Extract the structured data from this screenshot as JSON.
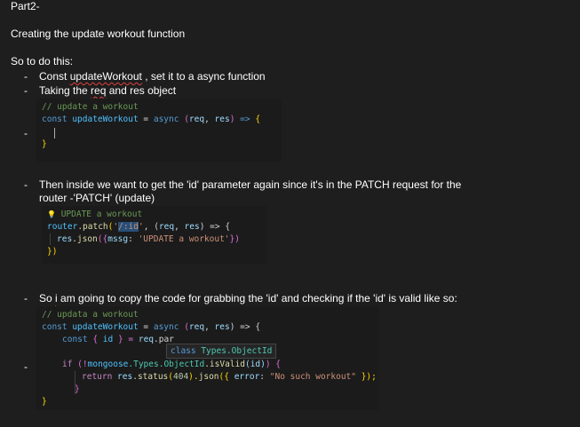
{
  "doc": {
    "part_title": "Part2-",
    "heading": "Creating the update workout function",
    "intro": "So to do this:",
    "bullets": {
      "b1_pre": "Const ",
      "b1_under": "updateWorkout",
      "b1_post": " , set it to a async function",
      "b2_pre": "Taking the ",
      "b2_under": "req",
      "b2_post": " and res object",
      "b4_line1": "Then inside we want to get the 'id' parameter again since it's in the PATCH request for the",
      "b4_line2": "router  -'PATCH' (update)",
      "b6_pre": "So ",
      "b6_under": "i",
      "b6_post": " am going to copy the code for grabbing the 'id' and checking if the 'id' is valid like so:"
    },
    "dash": "-"
  },
  "code1": {
    "comment": "// update a workout",
    "const": "const",
    "name": " updateWorkout",
    "eq": " = ",
    "async": "async",
    "params_open": " (",
    "req": "req",
    "comma": ", ",
    "res": "res",
    "params_close": ") ",
    "arrow": "=>",
    "brace_open": " {",
    "brace_close": "}"
  },
  "code2": {
    "bulb": "💡",
    "comment": " UPDATE a workout",
    "router": "router",
    "dot_patch": ".patch",
    "paren_open": "(",
    "str_q1": "'",
    "str_path": "/:id",
    "str_q2": "'",
    "comma": ", (",
    "req": "req",
    "comma2": ", ",
    "res": "res",
    "arrow_part": ") => {",
    "res_json_res": "res",
    "res_json": ".json",
    "json_open": "({",
    "mssg": "mssg",
    "colon": ": ",
    "msg_str": "'UPDATE a workout'",
    "json_close": "})",
    "close": "})"
  },
  "code3": {
    "comment": "// updata  a workout",
    "const": "const",
    "name": " updateWorkout",
    "eq": " = ",
    "async": "async",
    "params_open": " (",
    "req": "req",
    "comma": ", ",
    "res": "res",
    "params_close": ") => {",
    "l2_const": "const",
    "l2_destr": " { ",
    "l2_id": "id",
    "l2_destr_close": " } = ",
    "l2_req": "req",
    "l2_rest": ".par",
    "tooltip_kw": "class",
    "tooltip_type": " Types.ObjectId",
    "l3_if": "if",
    "l3_open": " (!",
    "l3_mongoose": "mongoose",
    "l3_types": ".Types.",
    "l3_objid": "ObjectId",
    "l3_isvalid": ".isValid",
    "l3_id": "(id)",
    "l3_close": ") {",
    "l4_return": "return",
    "l4_res": " res",
    "l4_status": ".status",
    "l4_num_open": "(",
    "l4_num": "404",
    "l4_num_close": ").",
    "l4_json": "json",
    "l4_obj_open": "({ ",
    "l4_error": "error",
    "l4_colon": ": ",
    "l4_str": "\"No such workout\"",
    "l4_end": " });",
    "l5_brace": "}",
    "l6_brace": "}"
  }
}
